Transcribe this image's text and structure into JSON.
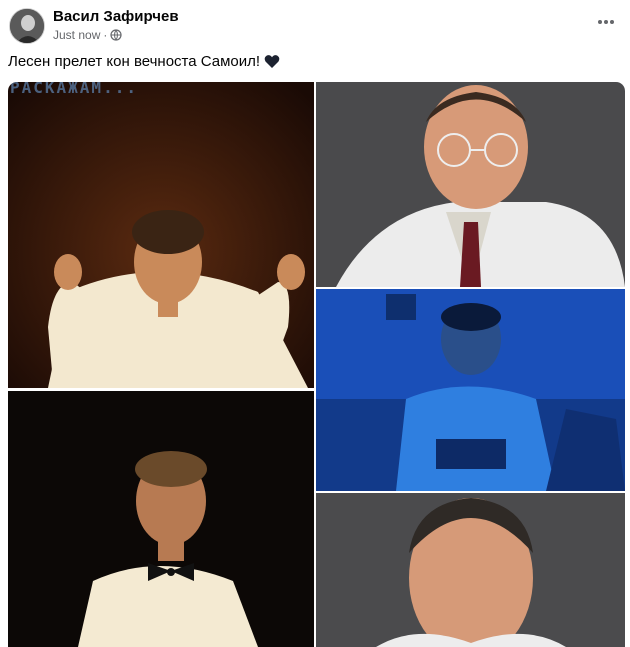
{
  "post": {
    "author": "Васил Зафирчев",
    "timestamp": "Just now",
    "separator": "·",
    "privacy_icon": "globe-icon",
    "more_icon": "more-options-icon",
    "text": "Лесен прелет кон вечноста Самоил!",
    "emoji_icon": "black-heart-icon"
  },
  "photos": {
    "photo1_overlay": "РАСКАЖАМ..."
  },
  "colors": {
    "text_primary": "#050505",
    "text_secondary": "#65676b",
    "blue_tint": "#1e4fb0"
  }
}
